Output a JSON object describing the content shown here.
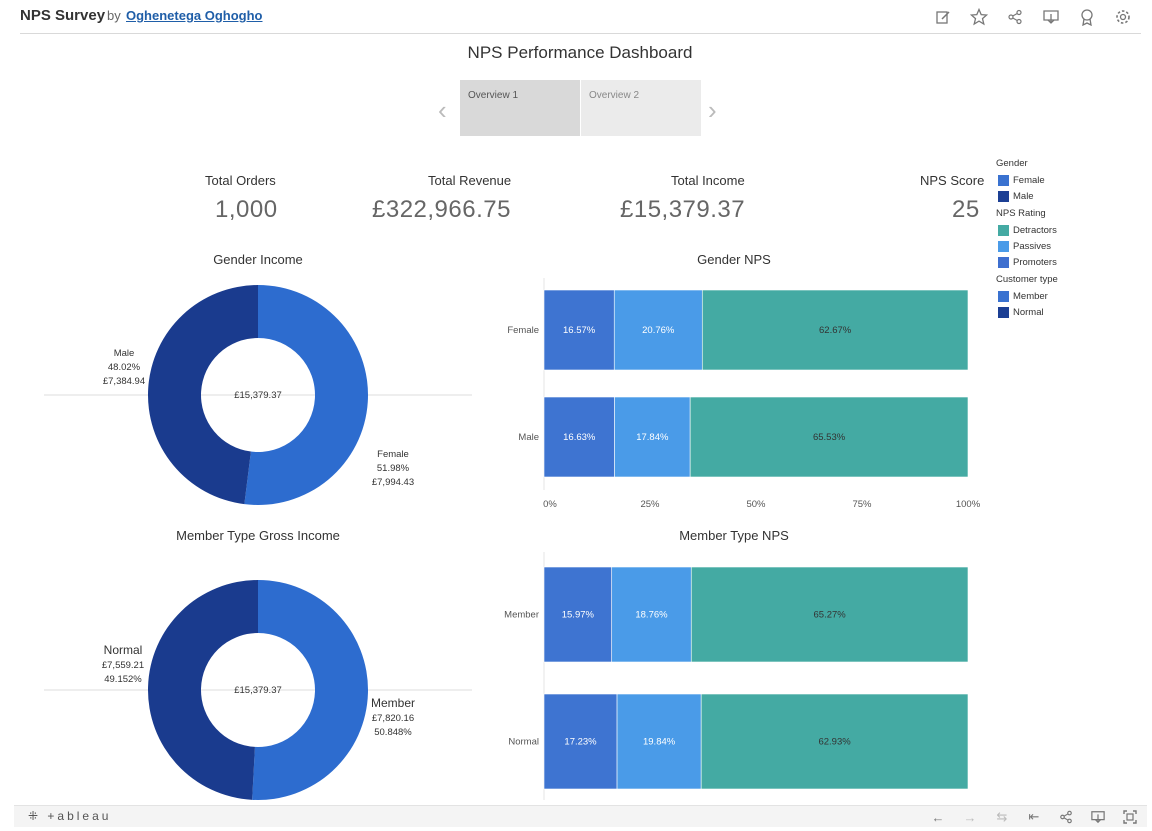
{
  "header": {
    "title": "NPS Survey",
    "by": "by",
    "author": "Oghenetega Oghogho",
    "icons": [
      "edit-icon",
      "star-icon",
      "share-icon",
      "download-icon",
      "badge-icon",
      "settings-icon"
    ]
  },
  "dashboard": {
    "title": "NPS Performance Dashboard",
    "tabs": [
      {
        "label": "Overview 1",
        "active": true
      },
      {
        "label": "Overview 2",
        "active": false
      }
    ]
  },
  "kpis": [
    {
      "label": "Total Orders",
      "value": "1,000"
    },
    {
      "label": "Total Revenue",
      "value": "£322,966.75"
    },
    {
      "label": "Total Income",
      "value": "£15,379.37"
    },
    {
      "label": "NPS Score",
      "value": "25"
    }
  ],
  "legend": {
    "groups": [
      {
        "title": "Gender",
        "items": [
          {
            "label": "Female",
            "color": "#3a72d0"
          },
          {
            "label": "Male",
            "color": "#1c3f94"
          }
        ]
      },
      {
        "title": "NPS Rating",
        "items": [
          {
            "label": "Detractors",
            "color": "#44aaa3"
          },
          {
            "label": "Passives",
            "color": "#4a9be8"
          },
          {
            "label": "Promoters",
            "color": "#3e6fcf"
          }
        ]
      },
      {
        "title": "Customer type",
        "items": [
          {
            "label": "Member",
            "color": "#3a72d0"
          },
          {
            "label": "Normal",
            "color": "#1c3f94"
          }
        ]
      }
    ]
  },
  "chart_data": [
    {
      "type": "pie",
      "title": "Gender Income",
      "center_label": "£15,379.37",
      "slices": [
        {
          "name": "Female",
          "percent": 51.98,
          "percent_label": "51.98%",
          "value_label": "£7,994.43",
          "color": "#2d6ccf"
        },
        {
          "name": "Male",
          "percent": 48.02,
          "percent_label": "48.02%",
          "value_label": "£7,384.94",
          "color": "#1a3b8e"
        }
      ]
    },
    {
      "type": "bar",
      "stacked": true,
      "orientation": "horizontal",
      "title": "Gender NPS",
      "categories": [
        "Female",
        "Male"
      ],
      "series": [
        {
          "name": "Promoters",
          "color": "#3e74d1",
          "values": [
            16.57,
            16.63
          ],
          "labels": [
            "16.57%",
            "16.63%"
          ]
        },
        {
          "name": "Passives",
          "color": "#4a9be8",
          "values": [
            20.76,
            17.84
          ],
          "labels": [
            "20.76%",
            "17.84%"
          ]
        },
        {
          "name": "Detractors",
          "color": "#44aaa3",
          "values": [
            62.67,
            65.53
          ],
          "labels": [
            "62.67%",
            "65.53%"
          ]
        }
      ],
      "xlim": [
        0,
        100
      ],
      "xticks": [
        "0%",
        "25%",
        "50%",
        "75%",
        "100%"
      ]
    },
    {
      "type": "pie",
      "title": "Member Type Gross Income",
      "center_label": "£15,379.37",
      "slices": [
        {
          "name": "Member",
          "percent": 50.848,
          "percent_label": "50.848%",
          "value_label": "£7,820.16",
          "color": "#2d6ccf"
        },
        {
          "name": "Normal",
          "percent": 49.152,
          "percent_label": "49.152%",
          "value_label": "£7,559.21",
          "color": "#1a3b8e"
        }
      ]
    },
    {
      "type": "bar",
      "stacked": true,
      "orientation": "horizontal",
      "title": "Member Type NPS",
      "categories": [
        "Member",
        "Normal"
      ],
      "series": [
        {
          "name": "Promoters",
          "color": "#3e74d1",
          "values": [
            15.97,
            17.23
          ],
          "labels": [
            "15.97%",
            "17.23%"
          ]
        },
        {
          "name": "Passives",
          "color": "#4a9be8",
          "values": [
            18.76,
            19.84
          ],
          "labels": [
            "18.76%",
            "19.84%"
          ]
        },
        {
          "name": "Detractors",
          "color": "#44aaa3",
          "values": [
            65.27,
            62.93
          ],
          "labels": [
            "65.27%",
            "62.93%"
          ]
        }
      ],
      "xlim": [
        0,
        100
      ]
    }
  ],
  "footer": {
    "logo": "+ableau",
    "icons": [
      "undo-icon",
      "redo-icon",
      "revert-icon",
      "reset-icon",
      "share-icon",
      "download-icon",
      "fullscreen-icon"
    ]
  }
}
